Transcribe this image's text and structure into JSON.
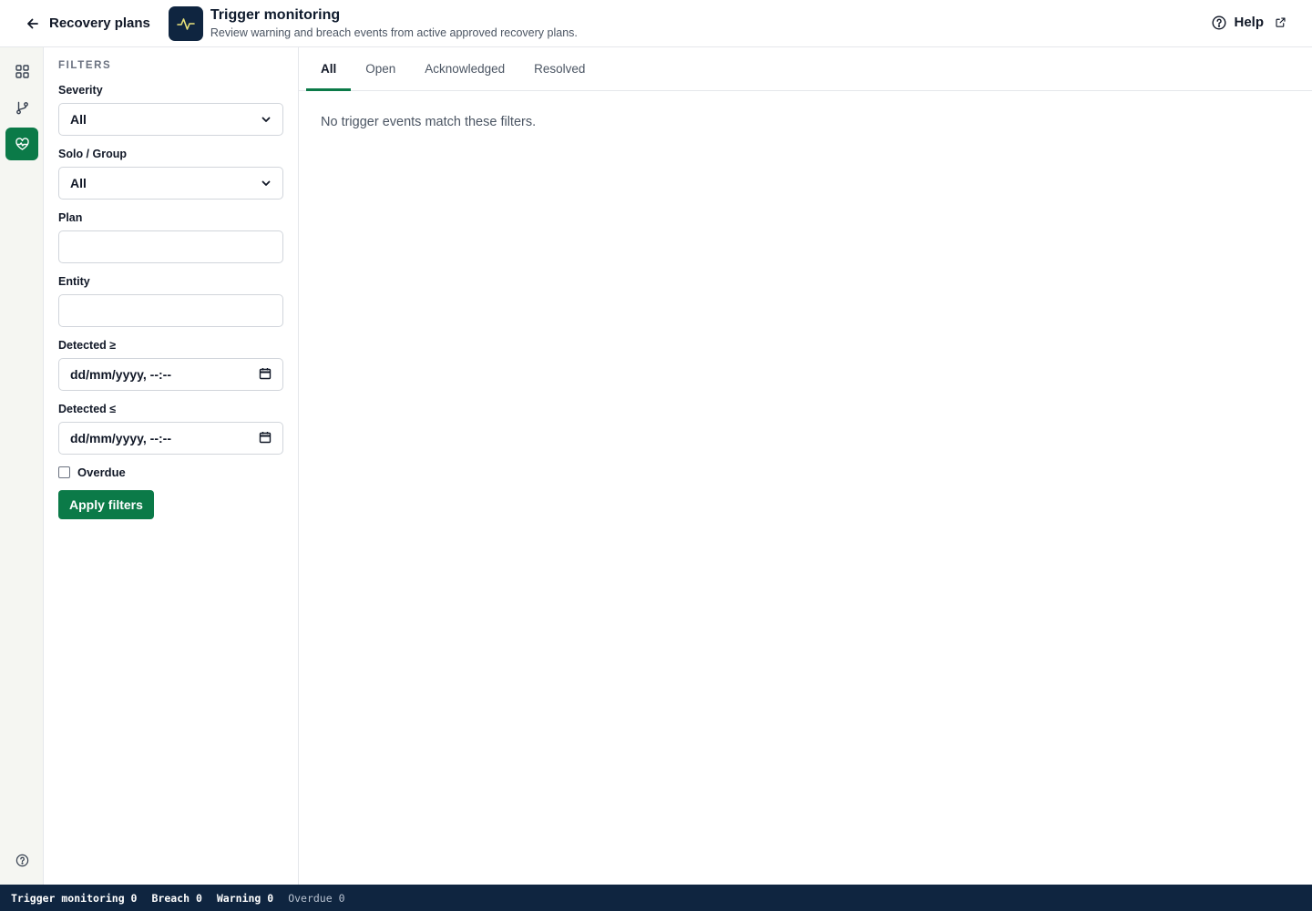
{
  "header": {
    "back_label": "Recovery plans",
    "title": "Trigger monitoring",
    "subtitle": "Review warning and breach events from active approved recovery plans.",
    "help_label": "Help",
    "logo_icon": "pulse-icon",
    "colors": {
      "logo_bg": "#0f2540",
      "logo_line": "#e8e27a"
    }
  },
  "rail": {
    "items": [
      {
        "icon": "grid-icon",
        "active": false
      },
      {
        "icon": "branch-icon",
        "active": false
      },
      {
        "icon": "heart-pulse-icon",
        "active": true
      }
    ],
    "bottom_icon": "help-circle-icon",
    "accent": "#0b7a48"
  },
  "filters": {
    "heading": "FILTERS",
    "severity": {
      "label": "Severity",
      "value": "All"
    },
    "solo_group": {
      "label": "Solo / Group",
      "value": "All"
    },
    "plan": {
      "label": "Plan",
      "value": ""
    },
    "entity": {
      "label": "Entity",
      "value": ""
    },
    "detected_from": {
      "label": "Detected ≥",
      "value": "dd/mm/yyyy, --:--"
    },
    "detected_to": {
      "label": "Detected ≤",
      "value": "dd/mm/yyyy, --:--"
    },
    "overdue": {
      "label": "Overdue",
      "checked": false
    },
    "apply_label": "Apply filters"
  },
  "tabs": [
    {
      "label": "All",
      "active": true
    },
    {
      "label": "Open",
      "active": false
    },
    {
      "label": "Acknowledged",
      "active": false
    },
    {
      "label": "Resolved",
      "active": false
    }
  ],
  "main": {
    "empty_message": "No trigger events match these filters."
  },
  "statusbar": {
    "trigger_monitoring": "Trigger monitoring 0",
    "breach": "Breach 0",
    "warning": "Warning 0",
    "overdue": "Overdue 0",
    "bg": "#0f2540"
  }
}
